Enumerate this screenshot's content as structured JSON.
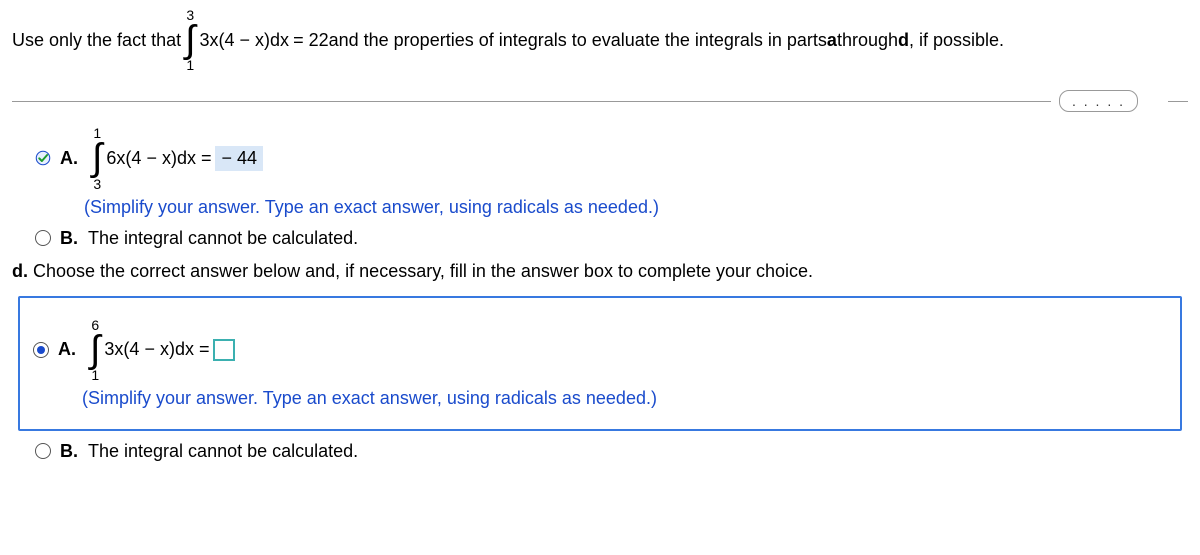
{
  "intro": {
    "prefix": "Use only the fact that",
    "integral": {
      "upper": "3",
      "lower": "1",
      "integrand": "3x(4 − x)dx"
    },
    "equals": "= 22",
    "suffix1": " and the properties of integrals to evaluate the integrals in parts ",
    "bold_a": "a",
    "through": " through ",
    "bold_d": "d",
    "suffix2": ", if possible."
  },
  "dots": ". . . . .",
  "part_c": {
    "optionA": {
      "letter": "A.",
      "integral": {
        "upper": "1",
        "lower": "3",
        "integrand": "6x(4 − x)dx ="
      },
      "answer": "− 44",
      "instruction": "(Simplify your answer. Type an exact answer, using radicals as needed.)"
    },
    "optionB": {
      "letter": "B.",
      "text": "The integral cannot be calculated."
    }
  },
  "part_d": {
    "prompt_prefix": "d.",
    "prompt": " Choose the correct answer below and, if necessary, fill in the answer box to complete your choice.",
    "optionA": {
      "letter": "A.",
      "integral": {
        "upper": "6",
        "lower": "1",
        "integrand": "3x(4 − x)dx ="
      },
      "instruction": "(Simplify your answer. Type an exact answer, using radicals as needed.)"
    },
    "optionB": {
      "letter": "B.",
      "text": "The integral cannot be calculated."
    }
  }
}
